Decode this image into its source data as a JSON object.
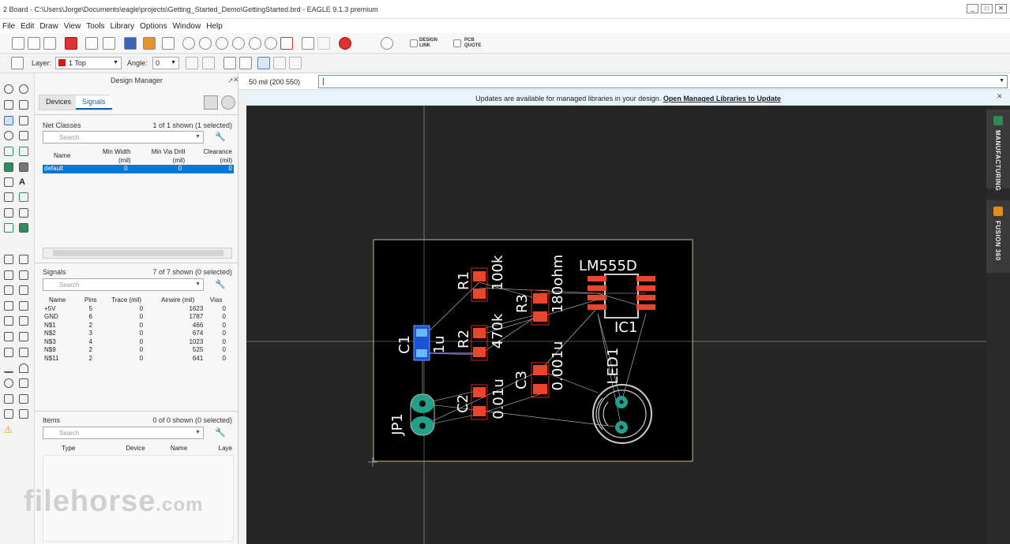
{
  "window": {
    "title": "2 Board - C:\\Users\\Jorge\\Documents\\eagle\\projects\\Getting_Started_Demo\\GettingStarted.brd - EAGLE 9.1.3 premium"
  },
  "menu": [
    "File",
    "Edit",
    "Draw",
    "View",
    "Tools",
    "Library",
    "Options",
    "Window",
    "Help"
  ],
  "toolbar": {
    "design_link": "DESIGN\nLINK",
    "pcb_quote": "PCB\nQUOTE"
  },
  "params": {
    "layer_label": "Layer:",
    "layer_value": "1 Top",
    "layer_color": "#cc1f1a",
    "angle_label": "Angle:",
    "angle_value": "0"
  },
  "design_manager": {
    "title": "Design Manager",
    "tabs": [
      "Devices",
      "Signals"
    ],
    "active_tab": "Signals",
    "net_classes": {
      "label": "Net Classes",
      "count": "1 of 1 shown (1 selected)",
      "search_placeholder": "Search",
      "headers": [
        "Name",
        "Min Width\n(mil)",
        "Min Via Drill\n(mil)",
        "Clearance\n(mil)"
      ],
      "rows": [
        [
          "default",
          "0",
          "0",
          "0"
        ]
      ]
    },
    "signals": {
      "label": "Signals",
      "count": "7 of 7 shown (0 selected)",
      "search_placeholder": "Search",
      "headers": [
        "Name",
        "Pins",
        "Trace (mil)",
        "Airwire (mil)",
        "Vias"
      ],
      "rows": [
        [
          "+5V",
          "5",
          "0",
          "1623",
          "0"
        ],
        [
          "GND",
          "6",
          "0",
          "1787",
          "0"
        ],
        [
          "N$1",
          "2",
          "0",
          "466",
          "0"
        ],
        [
          "N$2",
          "3",
          "0",
          "674",
          "0"
        ],
        [
          "N$3",
          "4",
          "0",
          "1023",
          "0"
        ],
        [
          "N$9",
          "2",
          "0",
          "525",
          "0"
        ],
        [
          "N$11",
          "2",
          "0",
          "641",
          "0"
        ]
      ]
    },
    "items": {
      "label": "Items",
      "count": "0 of 0 shown (0 selected)",
      "search_placeholder": "Search",
      "headers": [
        "Type",
        "Device",
        "Name",
        "Laye"
      ]
    }
  },
  "command": {
    "coords": "50 mil (200 550)",
    "value": "|"
  },
  "notice": {
    "text": "Updates are available for managed libraries in your design.",
    "link": "Open Managed Libraries to Update"
  },
  "board": {
    "labels": {
      "r1": "R1",
      "r1v": "100k",
      "r2": "R2",
      "r2v": "470k",
      "r3": "R3",
      "r3v": "180ohm",
      "ic": "LM555D",
      "ic1": "IC1",
      "c1": "C1",
      "c1v": "1u",
      "c2": "C2",
      "c2v": "0.01u",
      "c3": "C3",
      "c3v": "0.001u",
      "led": "LED1",
      "jp": "JP1"
    }
  },
  "right_panel": {
    "manufacturing": "MANUFACTURING",
    "fusion": "FUSION 360"
  },
  "watermark": {
    "text": "filehorse",
    "suffix": ".com"
  },
  "colors": {
    "pad": "#e8452a",
    "via": "#22a08a",
    "canvas": "#262626"
  }
}
